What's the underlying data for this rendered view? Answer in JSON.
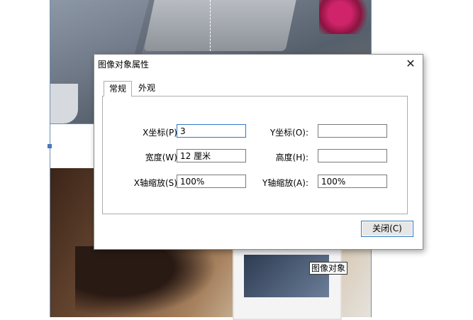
{
  "dialog": {
    "title": "图像对象属性",
    "close_glyph": "✕",
    "tabs": [
      {
        "label": "常规",
        "active": true
      },
      {
        "label": "外观",
        "active": false
      }
    ],
    "fields": {
      "x_label": "X坐标(P):",
      "x_value": "3",
      "y_label": "Y坐标(O):",
      "y_value": "",
      "width_label": "宽度(W):",
      "width_value": "12 厘米",
      "height_label": "高度(H):",
      "height_value": "",
      "x_scale_label": "X轴缩放(S):",
      "x_scale_value": "100%",
      "y_scale_label": "Y轴缩放(A):",
      "y_scale_value": "100%"
    },
    "close_button_label": "关闭(C)"
  },
  "tooltip": "图像对象",
  "colors": {
    "focus_border": "#2f78c4",
    "page_border": "#6d8fb8",
    "selection_handle": "#4a78b8"
  }
}
